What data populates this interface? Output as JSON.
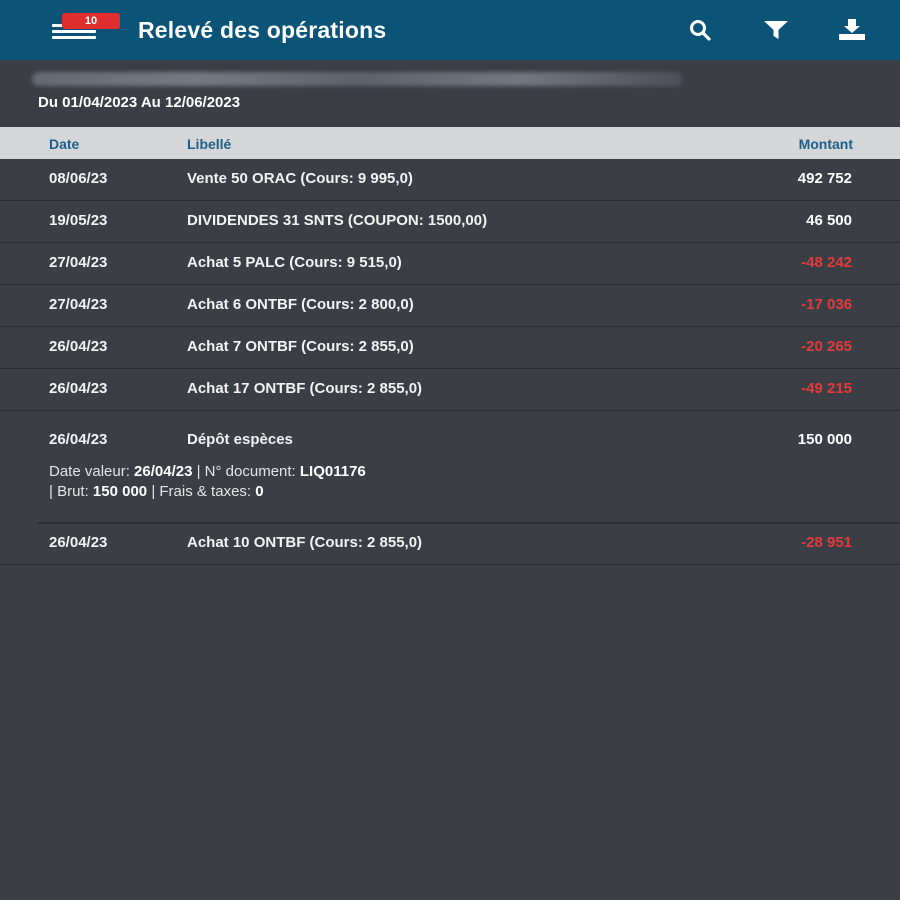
{
  "header": {
    "title": "Relevé des opérations",
    "badge_count": "10",
    "icons": [
      "menu-icon",
      "search-icon",
      "filter-icon",
      "download-icon"
    ],
    "bar_color": "#0b5478",
    "badge_color": "#e02d2d"
  },
  "period": {
    "text": "Du 01/04/2023 Au 12/06/2023"
  },
  "columns": {
    "date": "Date",
    "label": "Libellé",
    "amount": "Montant"
  },
  "operations": [
    {
      "date": "08/06/23",
      "label": "Vente 50 ORAC (Cours: 9 995,0)",
      "amount": "492 752",
      "sign": "pos"
    },
    {
      "date": "19/05/23",
      "label": "DIVIDENDES 31 SNTS (COUPON: 1500,00)",
      "amount": "46 500",
      "sign": "pos"
    },
    {
      "date": "27/04/23",
      "label": "Achat 5 PALC (Cours: 9 515,0)",
      "amount": "-48 242",
      "sign": "neg"
    },
    {
      "date": "27/04/23",
      "label": "Achat 6 ONTBF (Cours: 2 800,0)",
      "amount": "-17 036",
      "sign": "neg"
    },
    {
      "date": "26/04/23",
      "label": "Achat 7 ONTBF (Cours: 2 855,0)",
      "amount": "-20 265",
      "sign": "neg"
    },
    {
      "date": "26/04/23",
      "label": "Achat 17 ONTBF (Cours: 2 855,0)",
      "amount": "-49 215",
      "sign": "neg"
    },
    {
      "date": "26/04/23",
      "label": "Dépôt espèces",
      "amount": "150 000",
      "sign": "pos",
      "details": {
        "value_date_label": "Date valeur: ",
        "value_date": "26/04/23",
        "doc_label": " | N° document: ",
        "doc": "LIQ01176",
        "gross_label": "| Brut: ",
        "gross": "150 000",
        "fees_label": " | Frais & taxes: ",
        "fees": "0"
      }
    },
    {
      "date": "26/04/23",
      "label": "Achat 10 ONTBF (Cours: 2 855,0)",
      "amount": "-28 951",
      "sign": "neg"
    }
  ],
  "colors": {
    "background": "#3b3e45",
    "negative": "#e23b3b",
    "header_text": "#1d5f8a"
  }
}
